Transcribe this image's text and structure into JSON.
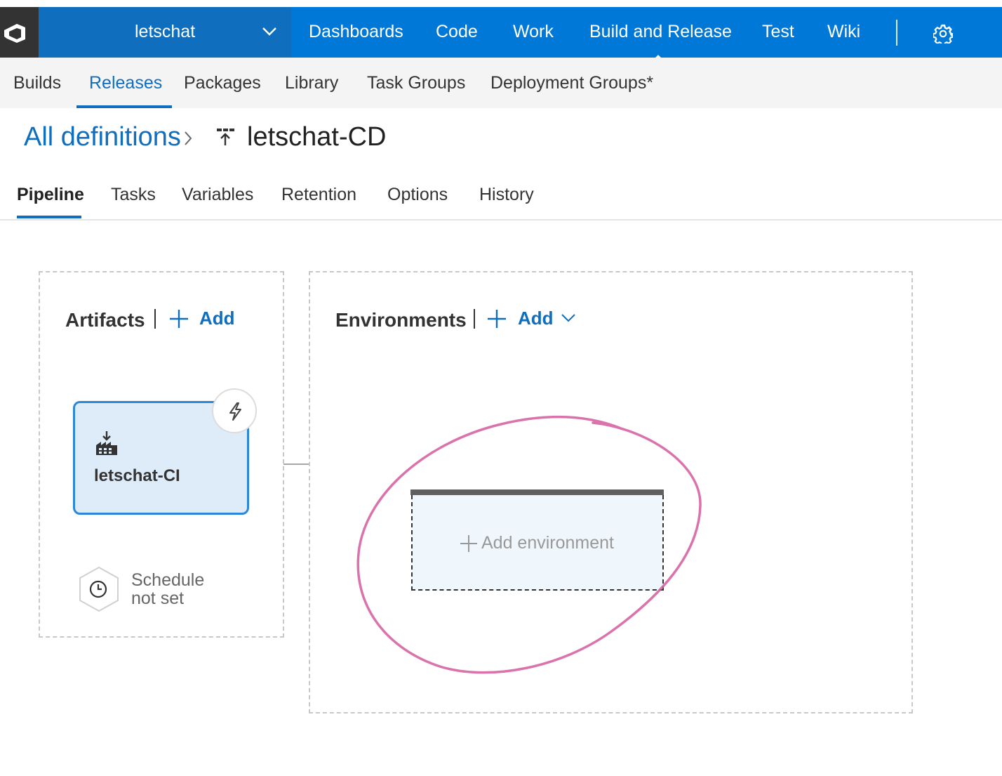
{
  "project": {
    "name": "letschat"
  },
  "hubs": [
    {
      "label": "Dashboards"
    },
    {
      "label": "Code"
    },
    {
      "label": "Work"
    },
    {
      "label": "Build and Release",
      "active": true
    },
    {
      "label": "Test"
    },
    {
      "label": "Wiki"
    }
  ],
  "subnav": [
    {
      "label": "Builds"
    },
    {
      "label": "Releases",
      "active": true
    },
    {
      "label": "Packages"
    },
    {
      "label": "Library"
    },
    {
      "label": "Task Groups"
    },
    {
      "label": "Deployment Groups*"
    }
  ],
  "breadcrumb": {
    "root": "All definitions",
    "current": "letschat-CD"
  },
  "pivots": [
    {
      "label": "Pipeline",
      "active": true
    },
    {
      "label": "Tasks"
    },
    {
      "label": "Variables"
    },
    {
      "label": "Retention"
    },
    {
      "label": "Options"
    },
    {
      "label": "History"
    }
  ],
  "artifacts": {
    "title": "Artifacts",
    "add_label": "Add",
    "items": [
      {
        "name": "letschat-CI"
      }
    ],
    "schedule": {
      "line1": "Schedule",
      "line2": "not set"
    }
  },
  "environments": {
    "title": "Environments",
    "add_label": "Add",
    "add_environment_label": "Add environment"
  },
  "icons": {
    "logo": "vsts-logo-icon",
    "project_dropdown": "chevron-down-icon",
    "settings": "gear-icon",
    "breadcrumb_separator": "chevron-right-icon",
    "definition": "release-definition-icon",
    "add": "plus-icon",
    "trigger": "lightning-icon",
    "artifact": "build-artifact-icon",
    "schedule": "clock-icon"
  },
  "colors": {
    "accent": "#0078d7",
    "link": "#106ebe",
    "artifact_card_bg": "#deecf9",
    "annotation_ink": "#d45a9c"
  }
}
